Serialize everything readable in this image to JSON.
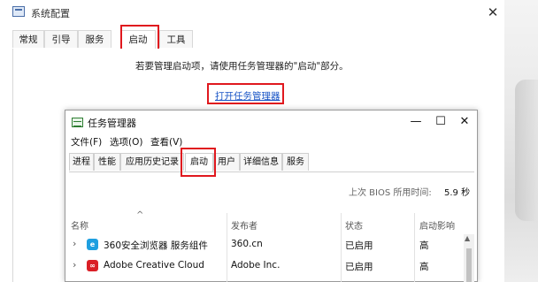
{
  "outer": {
    "title": "系统配置",
    "close": "✕",
    "tabs": [
      "常规",
      "引导",
      "服务",
      "启动",
      "工具"
    ],
    "hint": "若要管理启动项，请使用任务管理器的\"启动\"部分。",
    "link": "打开任务管理器"
  },
  "taskmgr": {
    "title": "任务管理器",
    "min": "—",
    "max": "☐",
    "close": "✕",
    "menu": [
      "文件(F)",
      "选项(O)",
      "查看(V)"
    ],
    "tabs": [
      "进程",
      "性能",
      "应用历史记录",
      "启动",
      "用户",
      "详细信息",
      "服务"
    ],
    "bios_label": "上次 BIOS 所用时间:",
    "bios_value": "5.9 秒",
    "columns": {
      "name": "名称",
      "publisher": "发布者",
      "status": "状态",
      "impact": "启动影响"
    },
    "sort_arrow": "^",
    "rows": [
      {
        "name": "360安全浏览器 服务组件",
        "publisher": "360.cn",
        "status": "已启用",
        "impact": "高",
        "icon": "360-browser-icon",
        "icon_color": "#1e9fe0",
        "icon_glyph": "e"
      },
      {
        "name": "Adobe Creative Cloud",
        "publisher": "Adobe Inc.",
        "status": "已启用",
        "impact": "高",
        "icon": "adobe-cc-icon",
        "icon_color": "#da1f26",
        "icon_glyph": "∞"
      }
    ]
  },
  "colors": {
    "highlight": "#e0181e",
    "link": "#1a55c6"
  }
}
